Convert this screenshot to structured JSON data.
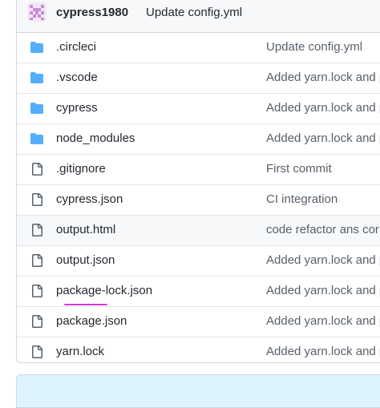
{
  "commit": {
    "author": "cypress1980",
    "message": "Update config.yml"
  },
  "files": [
    {
      "name": ".circleci",
      "type": "folder",
      "message": "Update config.yml"
    },
    {
      "name": ".vscode",
      "type": "folder",
      "message": "Added yarn.lock and p"
    },
    {
      "name": "cypress",
      "type": "folder",
      "message": "Added yarn.lock and p"
    },
    {
      "name": "node_modules",
      "type": "folder",
      "message": "Added yarn.lock and p"
    },
    {
      "name": ".gitignore",
      "type": "file",
      "message": "First commit"
    },
    {
      "name": "cypress.json",
      "type": "file",
      "message": "CI integration"
    },
    {
      "name": "output.html",
      "type": "file",
      "message": "code refactor ans cor"
    },
    {
      "name": "output.json",
      "type": "file",
      "message": "Added yarn.lock and p"
    },
    {
      "name": "package-lock.json",
      "type": "file",
      "message": "Added yarn.lock and p"
    },
    {
      "name": "package.json",
      "type": "file",
      "message": "Added yarn.lock and p"
    },
    {
      "name": "yarn.lock",
      "type": "file",
      "message": "Added yarn.lock and p"
    }
  ],
  "colors": {
    "folder_icon": "#54aeff",
    "file_icon": "#57606a",
    "annotation": "#d63ad6",
    "readme_bg": "#ddf4ff"
  }
}
